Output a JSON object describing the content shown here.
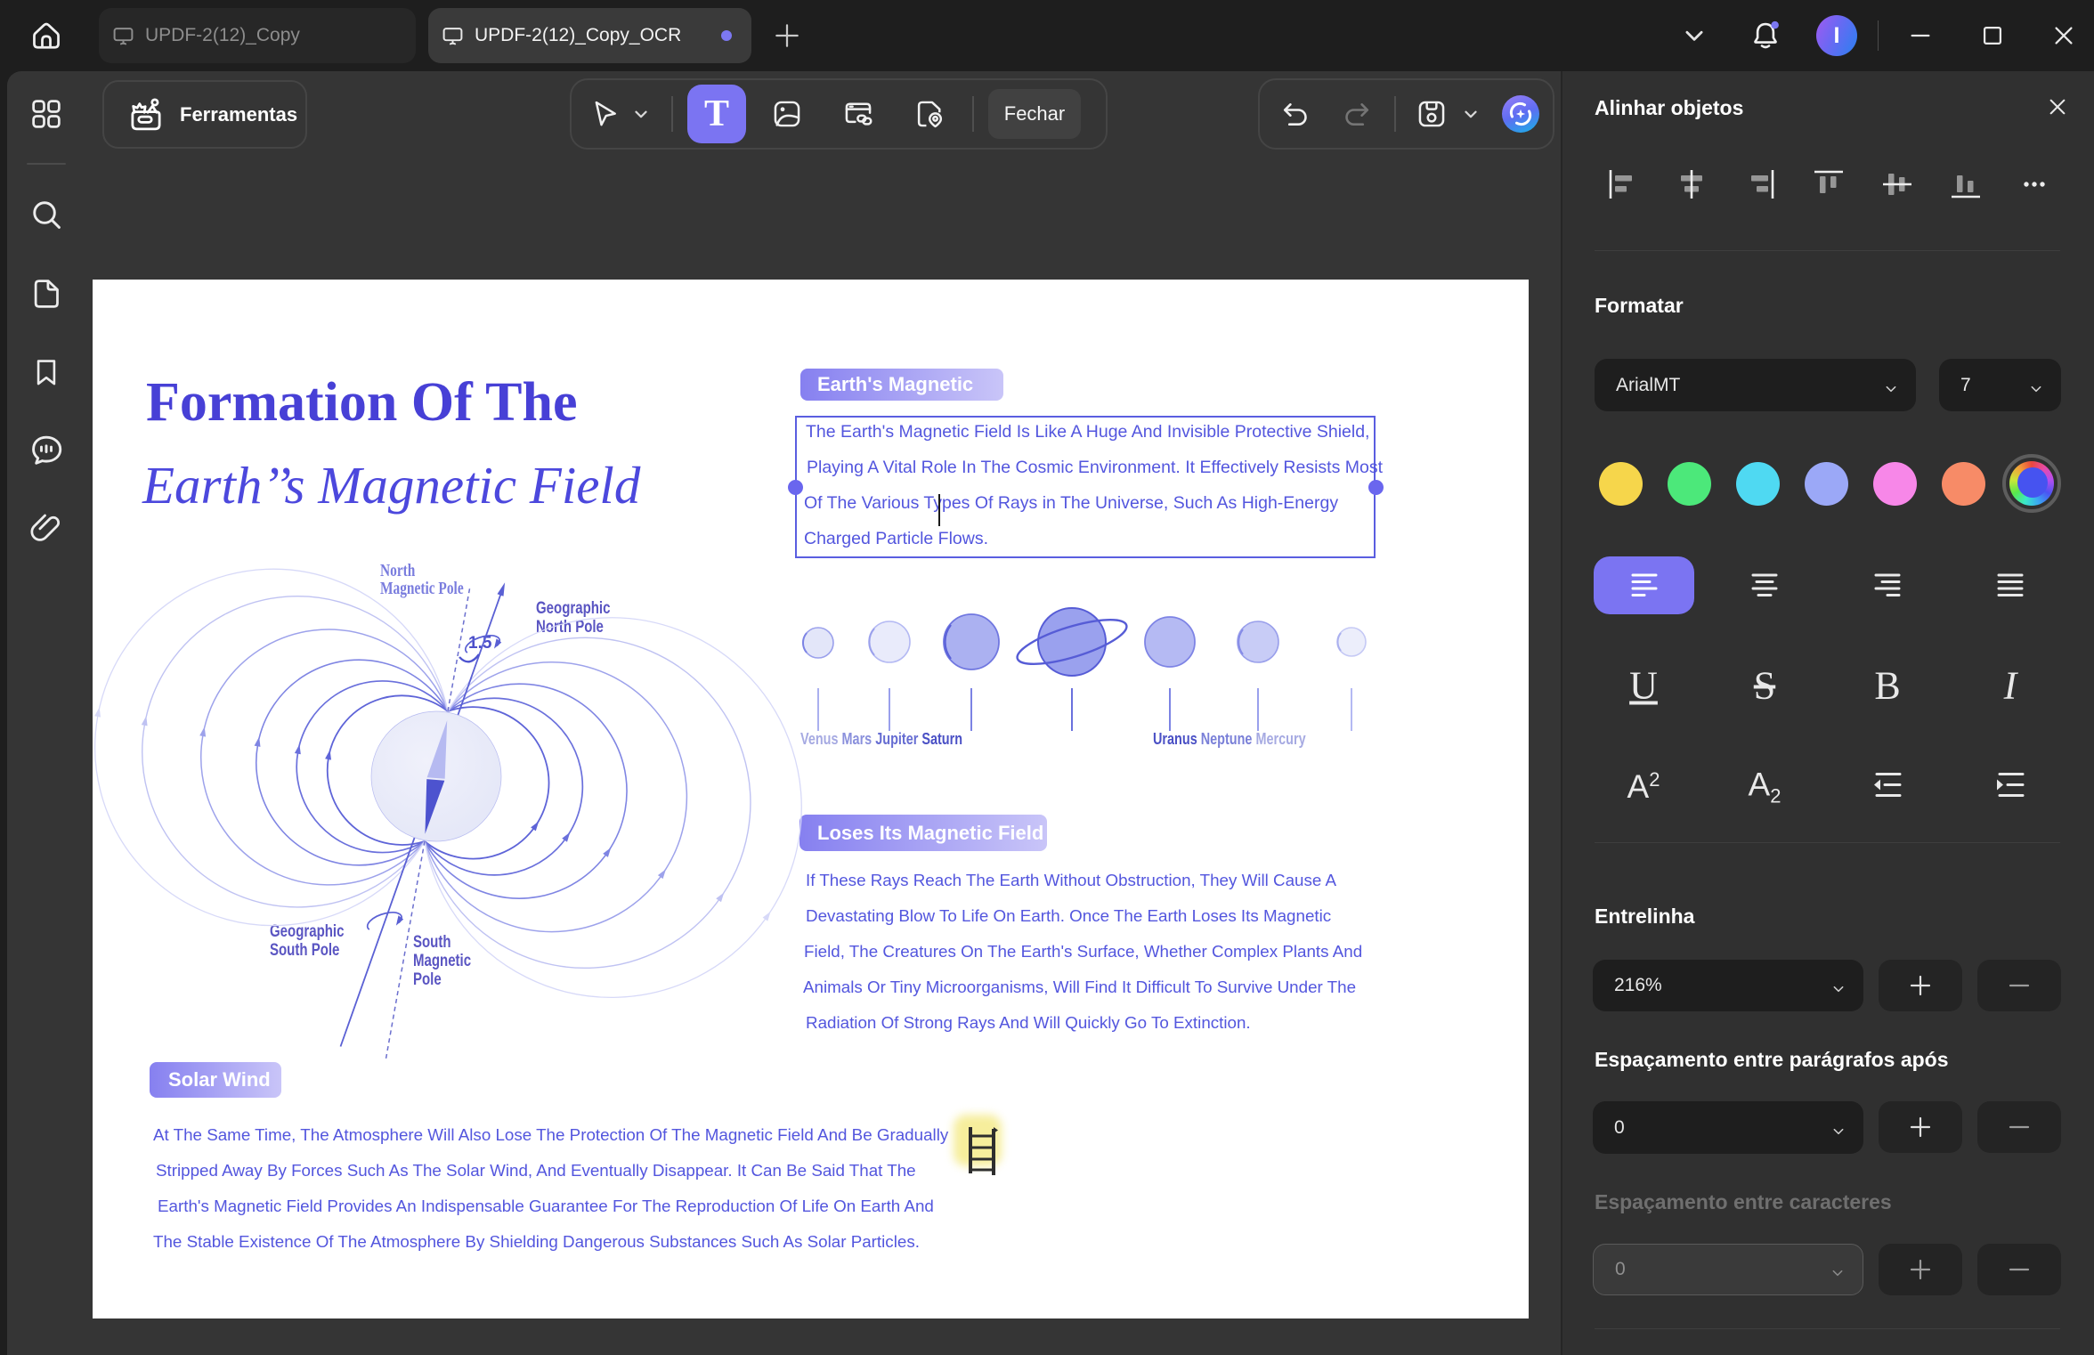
{
  "window": {
    "tab1_label": "UPDF-2(12)_Copy",
    "tab2_label": "UPDF-2(12)_Copy_OCR",
    "avatar_letter": "I"
  },
  "toolbar": {
    "tools_label": "Ferramentas",
    "text_tool_glyph": "T",
    "close_label": "Fechar"
  },
  "doc": {
    "title_line1": "Formation Of The",
    "title_line2": "Earth’’s Magnetic Field",
    "chip1": "Earth's Magnetic",
    "para1_lines": [
      "The Earth's Magnetic Field Is Like A Huge And Invisible Protective Shield,",
      "Playing A Vital Role In The Cosmic Environment. It Effectively Resists Most",
      "Of The Various Types Of Rays in The Universe, Such As High-Energy",
      "Charged Particle Flows."
    ],
    "chip2": "Loses Its Magnetic Field",
    "para2_lines": [
      "If These Rays Reach The Earth Without Obstruction, They Will Cause A",
      "Devastating Blow To Life On Earth. Once The Earth Loses Its Magnetic",
      "Field, The Creatures On The Earth's Surface, Whether Complex Plants And",
      "Animals Or Tiny Microorganisms, Will Find It Difficult To Survive Under The",
      "Radiation Of Strong Rays And Will Quickly Go To Extinction."
    ],
    "chip3": "Solar Wind",
    "para3_lines": [
      "At The Same Time, The Atmosphere Will Also Lose The Protection Of The Magnetic Field And Be Gradually",
      "Stripped Away By Forces Such As The Solar Wind, And Eventually Disappear. It Can Be Said That The",
      "Earth's Magnetic Field Provides An Indispensable Guarantee For The Reproduction Of Life On Earth And",
      "The Stable Existence Of The Atmosphere By Shielding Dangerous Substances Such As Solar Particles."
    ],
    "diagram": {
      "north_line1": "North",
      "north_line2": "Magnetic Pole",
      "geo_north_line1": "Geographic",
      "geo_north_line2": "North Pole",
      "angle_value": "1.5",
      "geo_south_line1": "Geographic",
      "geo_south_line2": "South Pole",
      "south_line1": "South",
      "south_line2": "Magnetic",
      "south_line3": "Pole"
    },
    "planets_left": [
      "Venus",
      "Mars",
      "Jupiter",
      "Saturn"
    ],
    "planets_right": [
      "Uranus",
      "Neptune",
      "Mercury"
    ]
  },
  "panel": {
    "title": "Alinhar objetos",
    "format_title": "Formatar",
    "font_name": "ArialMT",
    "font_size": "7",
    "underline_glyph": "U",
    "strike_glyph": "S",
    "bold_glyph": "B",
    "italic_glyph": "I",
    "superscript_base": "A",
    "superscript_exp": "2",
    "subscript_base": "A",
    "subscript_sub": "2",
    "line_spacing_label": "Entrelinha",
    "line_spacing_value": "216%",
    "para_spacing_label": "Espaçamento entre parágrafos após",
    "para_spacing_value": "0",
    "char_spacing_label": "Espaçamento entre caracteres",
    "char_spacing_value": "0",
    "swatch_colors": [
      "#f6d64b",
      "#4ce87a",
      "#4fd9f2",
      "#9ba8f7",
      "#f787e8",
      "#f78b67"
    ],
    "accent_color": "#7b74f2"
  }
}
